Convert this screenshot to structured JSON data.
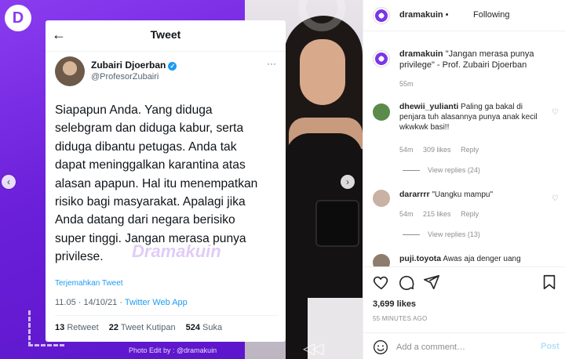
{
  "post": {
    "logo_letter": "D",
    "tweet": {
      "title": "Tweet",
      "author_name": "Zubairi Djoerban",
      "author_handle": "@ProfesorZubairi",
      "text_lines": [
        "Siapapun Anda. Yang diduga",
        "selebgram dan diduga kabur, serta",
        "diduga dibantu petugas. Anda tak",
        "dapat meninggalkan karantina atas",
        "alasan apapun. Hal itu menempatkan",
        "risiko bagi masyarakat. Apalagi jika",
        "Anda datang dari negara berisiko",
        "super tinggi. Jangan merasa punya",
        "privilese."
      ],
      "watermark": "Dramakuin",
      "translate_label": "Terjemahkan Tweet",
      "time": "11.05 · 14/10/21 ·",
      "app": "Twitter Web App",
      "retweets": "13",
      "retweets_label": "Retweet",
      "quotes": "22",
      "quotes_label": "Tweet Kutipan",
      "likes": "524",
      "likes_label": "Suka"
    },
    "credit": "Photo Edit by : @dramakuin"
  },
  "header": {
    "username": "dramakuin",
    "separator": "•",
    "following_label": "Following"
  },
  "caption": {
    "username": "dramakuin",
    "text": "\"Jangan merasa punya privilege\" - Prof. Zubairi Djoerban",
    "time": "55m"
  },
  "comments": [
    {
      "username": "dhewii_yulianti",
      "text": "Paling ga bakal di penjara tuh alasannya punya anak kecil wkwkwk basi!!",
      "time": "54m",
      "likes": "309 likes",
      "reply_label": "Reply",
      "view_replies": "View replies (24)",
      "avatar_color": "#5b8b4a"
    },
    {
      "username": "dararrrr",
      "text": "\"Uangku mampu\"",
      "time": "54m",
      "likes": "215 likes",
      "reply_label": "Reply",
      "view_replies": "View replies (13)",
      "avatar_color": "#c9b2a4"
    },
    {
      "username": "puji.toyota",
      "text": "Awas aja denger uang",
      "avatar_color": "#8e7c6e"
    }
  ],
  "actions": {
    "icons": [
      "heart-icon",
      "comment-icon",
      "share-icon",
      "bookmark-icon"
    ],
    "likes": "3,699 likes",
    "time_ago": "55 MINUTES AGO"
  },
  "add_comment": {
    "placeholder": "Add a comment…",
    "post_label": "Post"
  },
  "colors": {
    "brand_purple": "#7b35e8",
    "twitter_blue": "#1d9bf0",
    "post_disabled": "#b2dffc"
  }
}
